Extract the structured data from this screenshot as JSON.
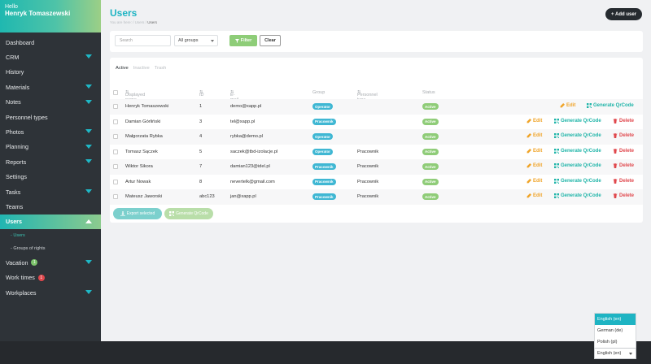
{
  "sidebar": {
    "hello": "Hello",
    "user_name": "Henryk Tomaszewski",
    "items": [
      {
        "label": "Dashboard",
        "chevron": false
      },
      {
        "label": "CRM",
        "chevron": true
      },
      {
        "label": "History",
        "chevron": false
      },
      {
        "label": "Materials",
        "chevron": true
      },
      {
        "label": "Notes",
        "chevron": true
      },
      {
        "label": "Personnel types",
        "chevron": false
      },
      {
        "label": "Photos",
        "chevron": true
      },
      {
        "label": "Planning",
        "chevron": true
      },
      {
        "label": "Reports",
        "chevron": true
      },
      {
        "label": "Settings",
        "chevron": false
      },
      {
        "label": "Tasks",
        "chevron": true
      },
      {
        "label": "Teams",
        "chevron": false
      },
      {
        "label": "Users",
        "chevron": true,
        "active": true
      }
    ],
    "subitems": [
      "- Users",
      "- Groups of rights"
    ],
    "items_after": [
      {
        "label": "Vacation",
        "badge": "1",
        "badge_color": "green",
        "chevron": true
      },
      {
        "label": "Work times",
        "badge": "1",
        "badge_color": "red",
        "chevron": false
      },
      {
        "label": "Workplaces",
        "chevron": true
      }
    ]
  },
  "header": {
    "title": "Users",
    "breadcrumb_prefix": "You are here:",
    "breadcrumb_mid": "Users",
    "breadcrumb_current": "Users",
    "add_user": "+ Add user"
  },
  "filters": {
    "search_placeholder": "Search",
    "group_select": "All groups",
    "filter_label": "Filter",
    "clear_label": "Clear"
  },
  "tabs": [
    "Active",
    "Inactive",
    "Trash"
  ],
  "table": {
    "headers": [
      "Displayed name",
      "ID",
      "E-mail",
      "Group",
      "Personnel type",
      "Status"
    ],
    "rows": [
      {
        "name": "Henryk Tomaszewski",
        "id": "1",
        "email": "demo@xapp.pl",
        "group": "Operator",
        "ptype": "",
        "status": "Active",
        "can_delete": false
      },
      {
        "name": "Damian Górliński",
        "id": "3",
        "email": "tel@xapp.pl",
        "group": "Pracownik",
        "ptype": "",
        "status": "Active",
        "can_delete": true
      },
      {
        "name": "Małgorzata Rybka",
        "id": "4",
        "email": "rybka@demo.pl",
        "group": "Operator",
        "ptype": "",
        "status": "Active",
        "can_delete": true
      },
      {
        "name": "Tomasz Sączek",
        "id": "5",
        "email": "saczek@tbd-izolacje.pl",
        "group": "Operator",
        "ptype": "Pracownik",
        "status": "Active",
        "can_delete": true
      },
      {
        "name": "Wiktor Sikora",
        "id": "7",
        "email": "damian123@idel.pl",
        "group": "Pracownik",
        "ptype": "Pracownik",
        "status": "Active",
        "can_delete": true
      },
      {
        "name": "Artur Nowak",
        "id": "8",
        "email": "nevertelk@gmail.com",
        "group": "Pracownik",
        "ptype": "Pracownik",
        "status": "Active",
        "can_delete": true
      },
      {
        "name": "Mateusz Jaworski",
        "id": "abc123",
        "email": "jan@xapp.pl",
        "group": "Pracownik",
        "ptype": "Pracownik",
        "status": "Active",
        "can_delete": true
      }
    ],
    "actions": {
      "edit": "Edit",
      "qr": "Generate QrCode",
      "delete": "Delete"
    }
  },
  "bulk": {
    "export": "Export selected",
    "generate": "Generate QrCode"
  },
  "language": {
    "options": [
      "English (en)",
      "German (de)",
      "Polish (pl)"
    ],
    "selected": "English (en)"
  },
  "colors": {
    "accent": "#1eb4c3",
    "green": "#8ecd78",
    "sidebar": "#2e3338",
    "edit": "#f0a428",
    "delete": "#e0474c"
  }
}
